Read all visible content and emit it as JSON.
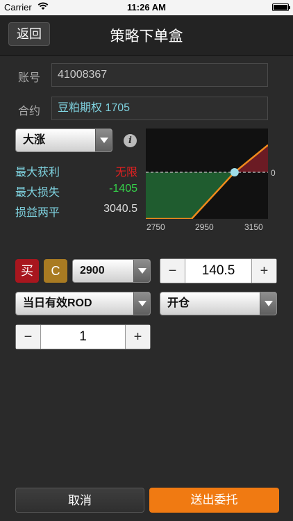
{
  "status": {
    "carrier": "Carrier",
    "time": "11:26 AM"
  },
  "nav": {
    "back_label": "返回",
    "title": "策略下单盒"
  },
  "account": {
    "label": "账号",
    "value": "41008367"
  },
  "contract": {
    "label": "合约",
    "value": "豆粕期权 1705"
  },
  "strategy": {
    "selected": "大涨"
  },
  "stats": {
    "max_profit_label": "最大获利",
    "max_profit_value": "无限",
    "max_loss_label": "最大损失",
    "max_loss_value": "-1405",
    "breakeven_label": "损益两平",
    "breakeven_value": "3040.5"
  },
  "chart_data": {
    "type": "line",
    "x_ticks": [
      "2750",
      "2950",
      "3150"
    ],
    "y_tick": "0",
    "series": [
      {
        "x": [
          2750,
          2900,
          3040.5,
          3150
        ],
        "y": [
          -1405,
          -1405,
          0,
          1095
        ]
      }
    ],
    "xlim": [
      2750,
      3150
    ],
    "breakeven_x": 3040.5,
    "colors": {
      "line": "#f08a1c",
      "loss_fill": "#1f5c2f",
      "profit_fill": "#6b1b24",
      "zero_line": "#aaaaaa",
      "marker": "#9fdce8"
    }
  },
  "order": {
    "side_label": "买",
    "type_label": "C",
    "strike": "2900",
    "price": "140.5",
    "validity": "当日有效ROD",
    "open_close": "开仓",
    "quantity": "1",
    "minus": "−",
    "plus": "+"
  },
  "actions": {
    "cancel_label": "取消",
    "submit_label": "送出委托"
  },
  "colors": {
    "accent": "#f07a12",
    "profit_red": "#e02020",
    "loss_green": "#35d24a",
    "buy_red": "#a8161e",
    "call_gold": "#a97b22"
  }
}
